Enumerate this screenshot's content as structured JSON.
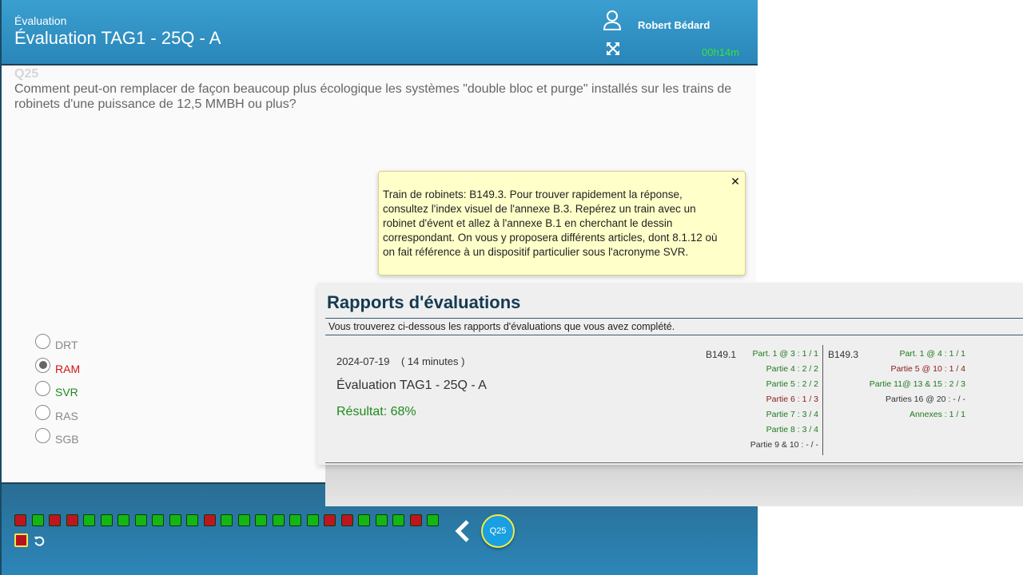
{
  "header": {
    "eyebrow": "Évaluation",
    "title": "Évaluation TAG1 - 25Q - A",
    "user_name": "Robert Bédard",
    "timer": "00h14m"
  },
  "question": {
    "number": "Q25",
    "text": "Comment peut-on remplacer de façon beaucoup plus écologique les systèmes \"double bloc et purge\" installés sur les trains de robinets d'une puissance de 12,5 MMBH ou plus?"
  },
  "tooltip": {
    "text": "Train de robinets: B149.3. Pour trouver rapidement la réponse, consultez l'index visuel de l'annexe B.3. Repérez un train avec un robinet d'évent et allez à l'annexe B.1 en cherchant le dessin correspondant. On vous y proposera différents articles, dont 8.1.12 où on fait référence à un dispositif particulier sous l'acronyme SVR.",
    "close_icon": "close-icon"
  },
  "options": [
    {
      "label": "DRT",
      "checked": false,
      "state": "neutral"
    },
    {
      "label": "RAM",
      "checked": true,
      "state": "wrong"
    },
    {
      "label": "SVR",
      "checked": false,
      "state": "correct"
    },
    {
      "label": "RAS",
      "checked": false,
      "state": "neutral"
    },
    {
      "label": "SGB",
      "checked": false,
      "state": "neutral"
    }
  ],
  "footer": {
    "question_status": [
      "r",
      "g",
      "r",
      "r",
      "g",
      "g",
      "g",
      "g",
      "g",
      "g",
      "g",
      "r",
      "g",
      "g",
      "g",
      "g",
      "g",
      "g",
      "r",
      "r",
      "g",
      "g",
      "g",
      "r",
      "g"
    ],
    "current_question_label": "Q25"
  },
  "report": {
    "title": "Rapports d'évaluations",
    "subtitle": "Vous trouverez ci-dessous les rapports d'évaluations que vous avez complété.",
    "date": "2024-07-19",
    "duration": "( 14 minutes )",
    "evaluation_name": "Évaluation TAG1 - 25Q - A",
    "result": "Résultat: 68%",
    "sections": [
      {
        "label": "B149.1",
        "parts": [
          {
            "text": "Part. 1 @ 3 :  1 / 1",
            "state": "g"
          },
          {
            "text": "Partie 4 :  2 / 2",
            "state": "g"
          },
          {
            "text": "Partie 5 :  2 / 2",
            "state": "g"
          },
          {
            "text": "Partie 6 :  1 / 3",
            "state": "r"
          },
          {
            "text": "Partie 7 :  3 / 4",
            "state": "g"
          },
          {
            "text": "Partie 8 :  3 / 4",
            "state": "g"
          },
          {
            "text": "Partie 9 & 10 :  - / -",
            "state": "k"
          }
        ]
      },
      {
        "label": "B149.3",
        "parts": [
          {
            "text": "Part. 1 @ 4 :  1 / 1",
            "state": "g"
          },
          {
            "text": "Partie 5 @ 10 :  1 / 4",
            "state": "r"
          },
          {
            "text": "Partie 11@ 13 & 15 :  2 / 3",
            "state": "g"
          },
          {
            "text": "Parties 16 @ 20 :  - / -",
            "state": "k"
          },
          {
            "text": "Annexes :  1 / 1",
            "state": "g"
          }
        ]
      }
    ]
  },
  "colors": {
    "header_bg": "#2a86b8",
    "timer": "#36e53a",
    "correct": "#1e8a1e",
    "wrong": "#d11414",
    "tooltip_bg": "#ffffc9"
  }
}
